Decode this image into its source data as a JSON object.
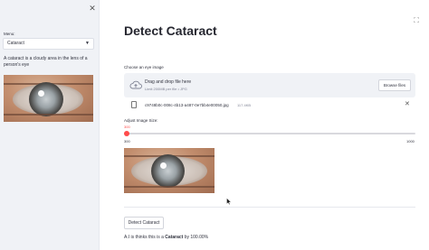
{
  "sidebar": {
    "close_glyph": "✕",
    "menu_label": "Menu:",
    "menu_selected": "Cataract",
    "description": "A cataract is a cloudy area in the lens of a person's eye",
    "image_icon": "eye-photo"
  },
  "main": {
    "title": "Detect Cataract",
    "fullscreen_glyph": "⛶",
    "uploader": {
      "label": "Choose an eye image",
      "drop_text": "Drag and drop file here",
      "limit_text": "Limit 200MB per file • JPG",
      "browse_label": "Browse files",
      "cloud_icon": "cloud-upload-icon"
    },
    "file": {
      "name": "c9748b0c-008c-4b13-a487-0e7bb4e00050.jpg",
      "size": "117.4KB",
      "delete_glyph": "✕"
    },
    "slider": {
      "label": "Adjust Image Size:",
      "value": "300",
      "min": "300",
      "max": "1000",
      "fraction": 0
    },
    "detect_button": "Detect Cataract",
    "result": {
      "prefix": "A.I is thinks this is a ",
      "label": "Cataract",
      "suffix": " by 100.00%"
    }
  },
  "colors": {
    "accent": "#ff4b4b",
    "sidebar_bg": "#f0f2f6",
    "text": "#31333f"
  }
}
